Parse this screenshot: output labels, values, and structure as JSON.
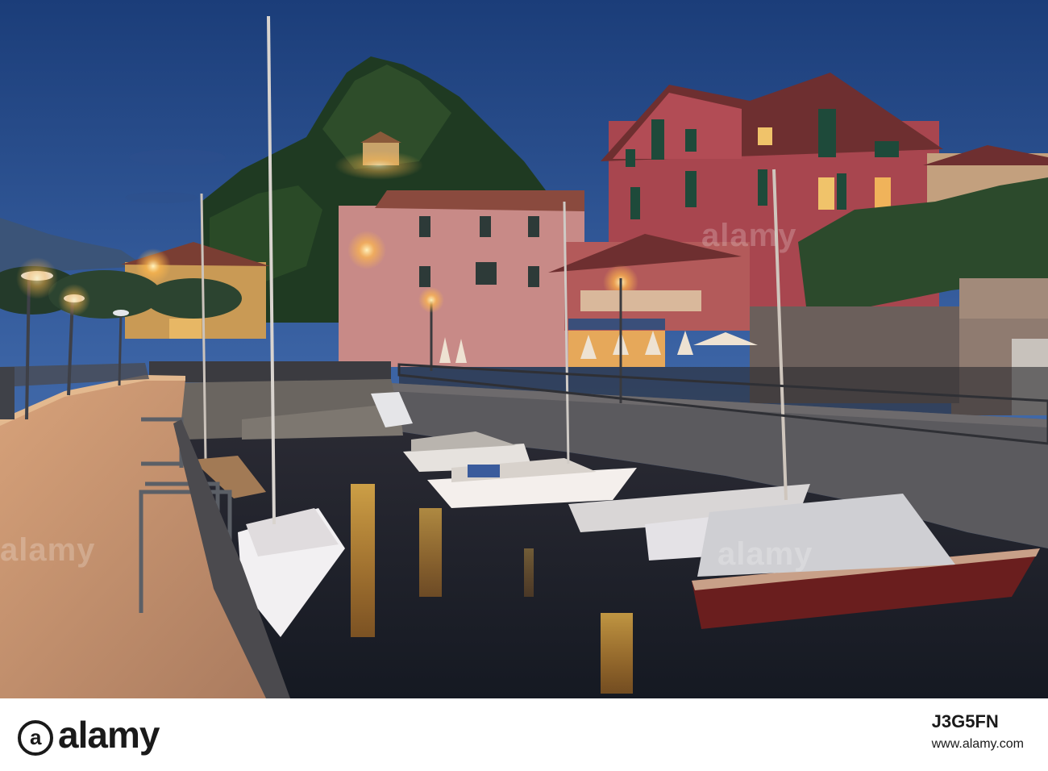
{
  "watermark": {
    "text": "alamy",
    "color": "#ffffff"
  },
  "footer": {
    "logo_text": "alamy",
    "logo_mark": "a",
    "image_id": "J3G5FN",
    "site_url": "www.alamy.com"
  },
  "colors": {
    "sky_top": "#1d3f7a",
    "sky_bottom": "#4f78b5",
    "house_red": "#b2495a",
    "lamp_glow": "#ffb84d",
    "water": "#1c2230",
    "promenade": "#c7926e"
  }
}
